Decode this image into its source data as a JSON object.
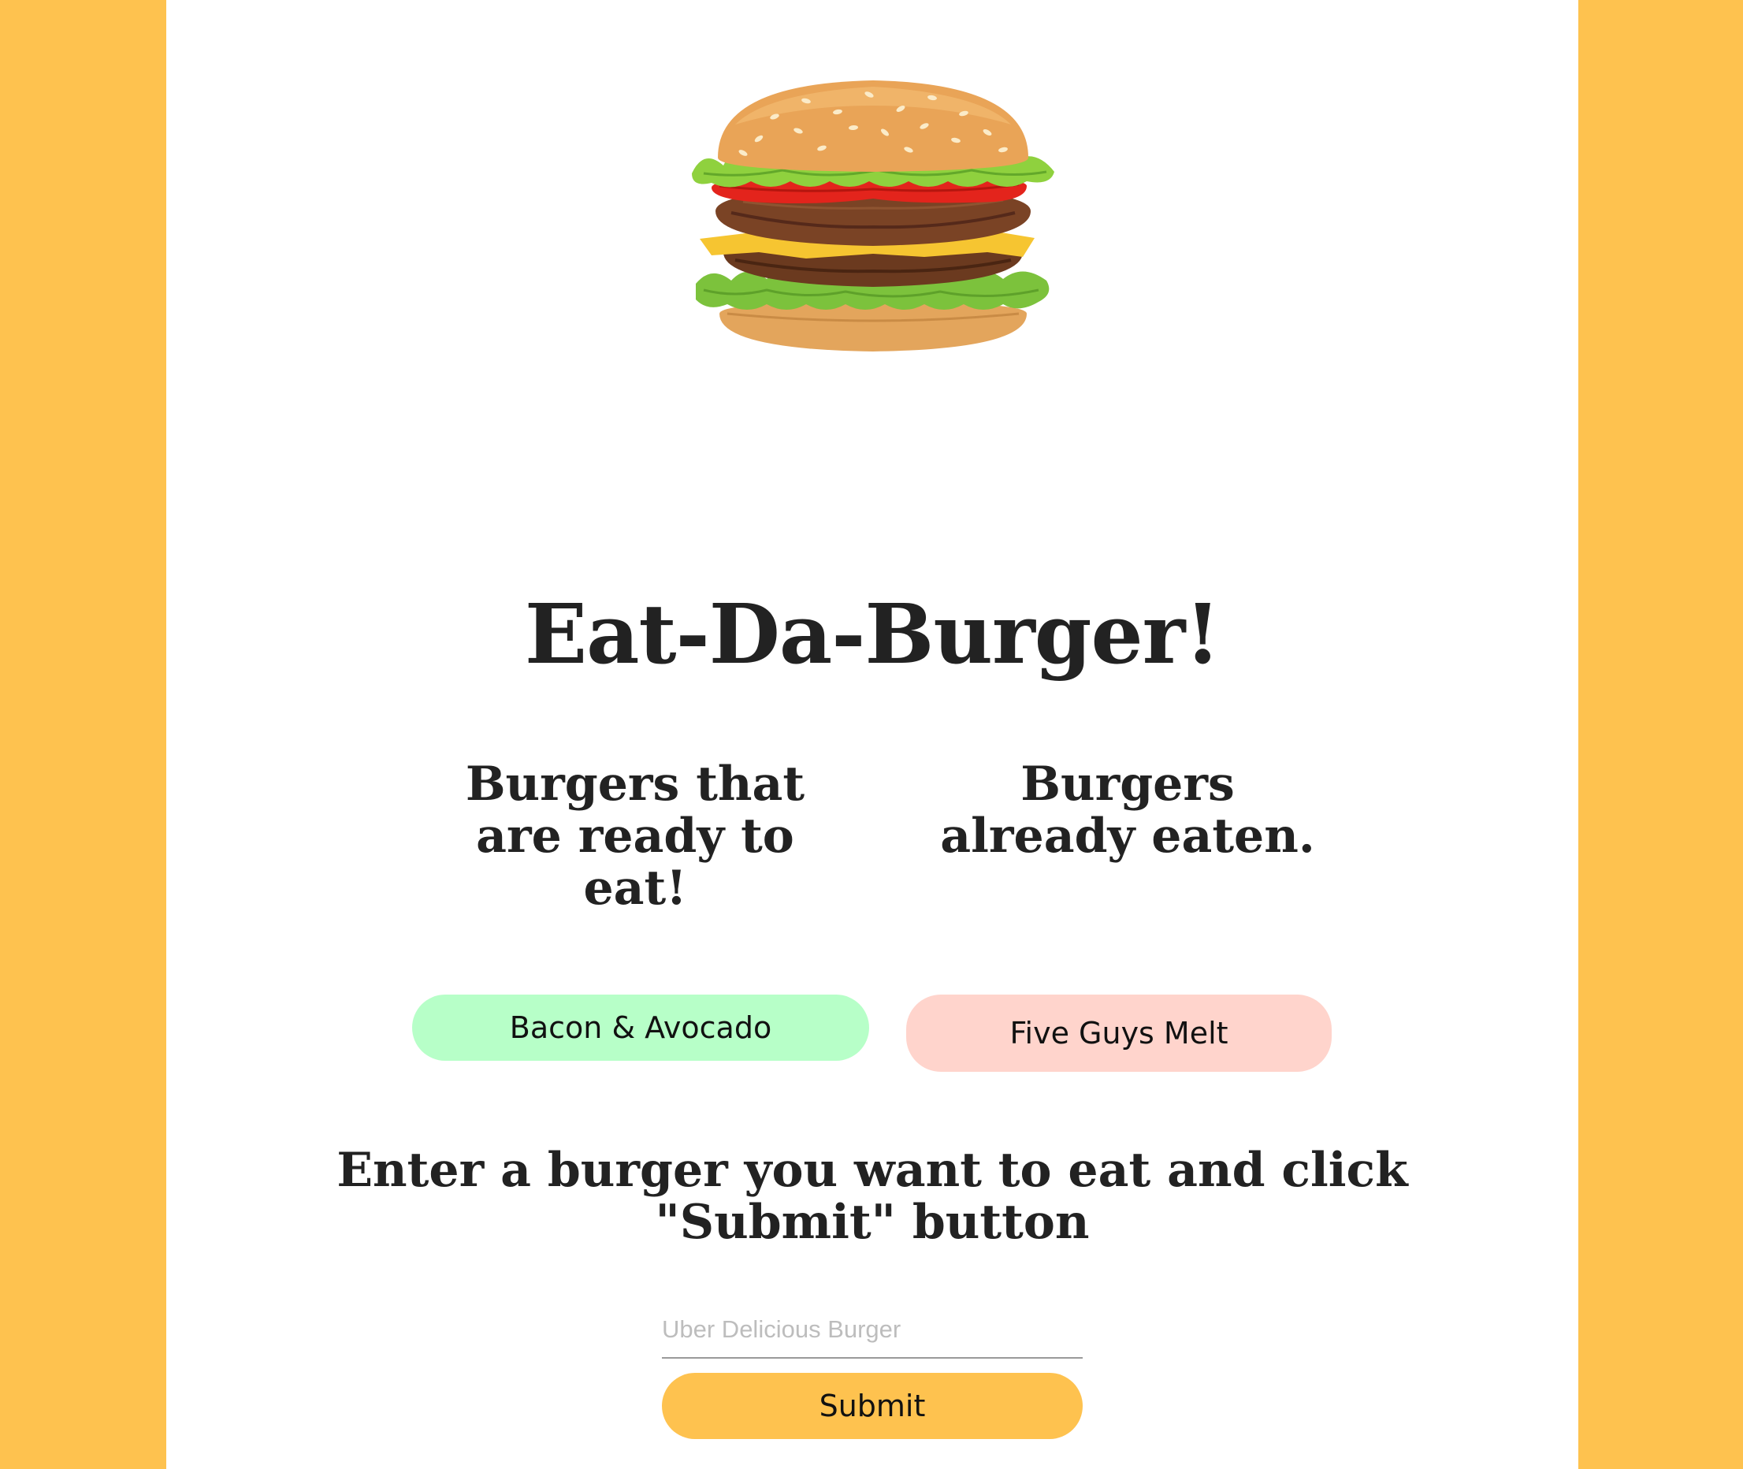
{
  "hero": {
    "image": "burger-image"
  },
  "title": "Eat-Da-Burger!",
  "columns": {
    "ready_heading": "Burgers that are ready to eat!",
    "eaten_heading": "Burgers already eaten."
  },
  "burgers": {
    "ready": [
      {
        "name": "Bacon & Avocado"
      }
    ],
    "eaten": [
      {
        "name": "Five Guys Melt"
      }
    ]
  },
  "form": {
    "prompt": "Enter a burger you want to eat and click \"Submit\" button",
    "input_placeholder": "Uber Delicious Burger",
    "input_value": "",
    "submit_label": "Submit"
  },
  "colors": {
    "background": "#FEC24F",
    "page": "#FFFFFF",
    "ready_pill": "#B7FFC8",
    "eaten_pill": "#FFD4CC",
    "submit_button": "#FEC24F",
    "text": "#222222"
  }
}
